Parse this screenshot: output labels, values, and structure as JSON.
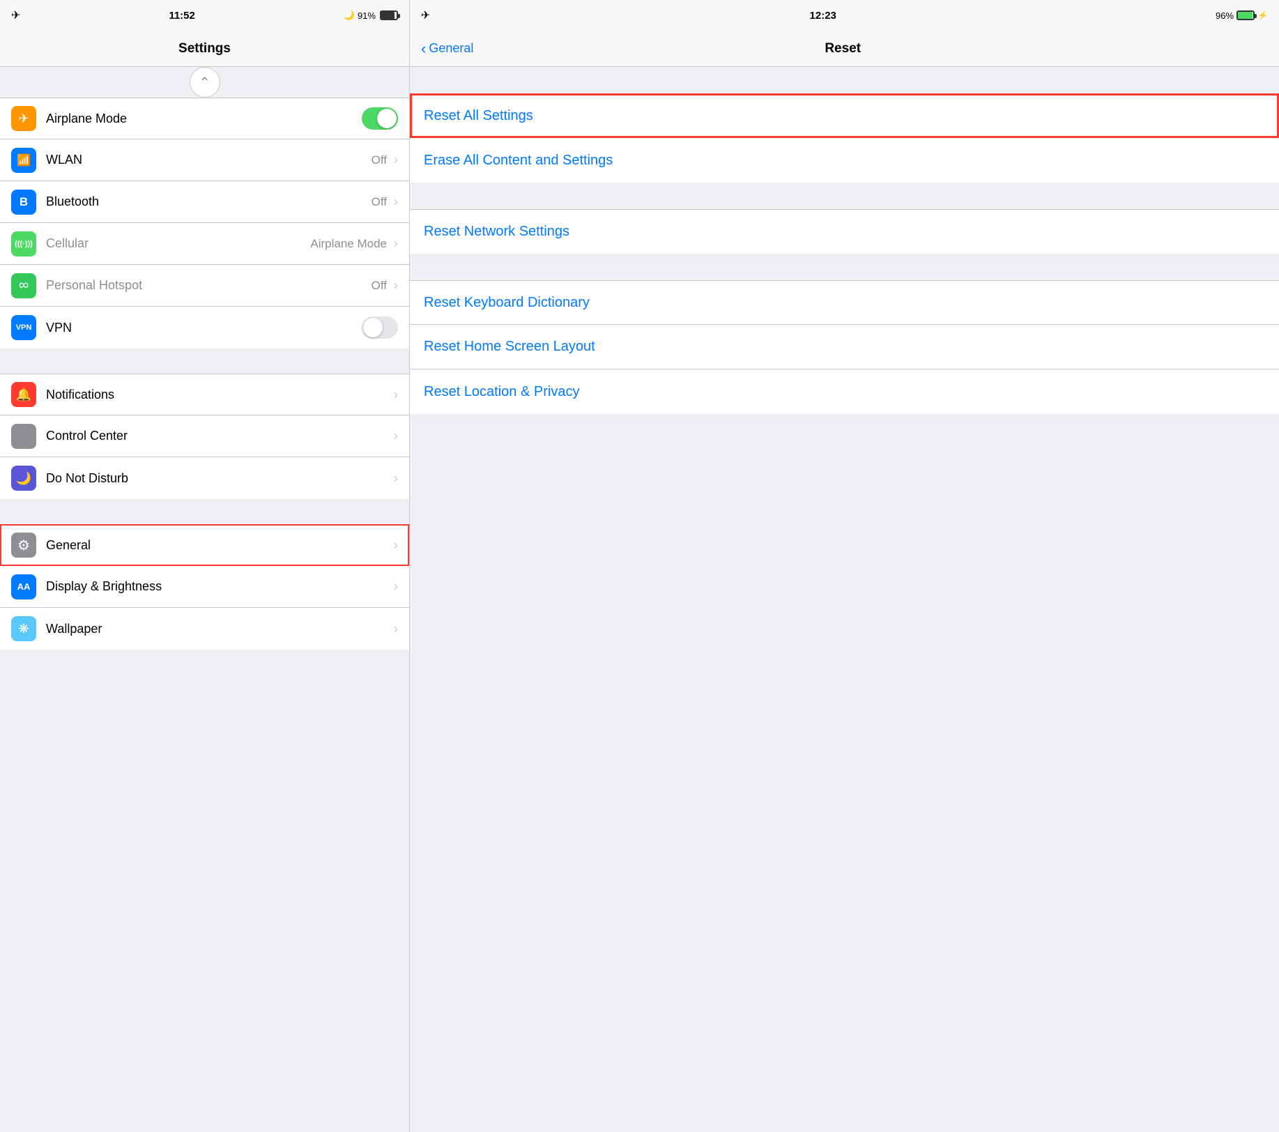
{
  "left": {
    "status": {
      "time": "11:52",
      "battery": "91%",
      "airplane": "✈"
    },
    "title": "Settings",
    "sections": [
      {
        "id": "connectivity",
        "items": [
          {
            "id": "airplane-mode",
            "label": "Airplane Mode",
            "icon": "✈",
            "icon_color": "icon-orange",
            "toggle": true,
            "toggle_on": true
          },
          {
            "id": "wlan",
            "label": "WLAN",
            "icon": "📶",
            "icon_color": "icon-blue",
            "value": "Off",
            "chevron": true
          },
          {
            "id": "bluetooth",
            "label": "Bluetooth",
            "icon": "B",
            "icon_color": "icon-blue-dark",
            "value": "Off",
            "chevron": true
          },
          {
            "id": "cellular",
            "label": "Cellular",
            "icon": "((·))",
            "icon_color": "icon-green",
            "value": "Airplane Mode",
            "chevron": true,
            "gray_label": true
          },
          {
            "id": "personal-hotspot",
            "label": "Personal Hotspot",
            "icon": "∞",
            "icon_color": "icon-green-dark",
            "value": "Off",
            "chevron": true,
            "gray_label": true
          },
          {
            "id": "vpn",
            "label": "VPN",
            "icon": "VPN",
            "icon_color": "icon-blue",
            "toggle": true,
            "toggle_on": false
          }
        ]
      },
      {
        "id": "system",
        "items": [
          {
            "id": "notifications",
            "label": "Notifications",
            "icon": "🔔",
            "icon_color": "icon-red",
            "chevron": true
          },
          {
            "id": "control-center",
            "label": "Control Center",
            "icon": "⊞",
            "icon_color": "icon-gray",
            "chevron": true
          },
          {
            "id": "do-not-disturb",
            "label": "Do Not Disturb",
            "icon": "🌙",
            "icon_color": "icon-purple",
            "chevron": true
          }
        ]
      },
      {
        "id": "more",
        "items": [
          {
            "id": "general",
            "label": "General",
            "icon": "⚙",
            "icon_color": "icon-gray",
            "chevron": true,
            "highlighted": true
          },
          {
            "id": "display-brightness",
            "label": "Display & Brightness",
            "icon": "AA",
            "icon_color": "icon-blue",
            "chevron": true
          },
          {
            "id": "wallpaper",
            "label": "Wallpaper",
            "icon": "❋",
            "icon_color": "icon-teal",
            "chevron": true
          }
        ]
      }
    ]
  },
  "right": {
    "status": {
      "time": "12:23",
      "battery": "96%",
      "airplane": "✈"
    },
    "back_label": "General",
    "title": "Reset",
    "sections": [
      {
        "id": "reset-main",
        "items": [
          {
            "id": "reset-all-settings",
            "label": "Reset All Settings",
            "highlighted": true
          },
          {
            "id": "erase-all",
            "label": "Erase All Content and Settings"
          }
        ]
      },
      {
        "id": "reset-network",
        "items": [
          {
            "id": "reset-network-settings",
            "label": "Reset Network Settings"
          }
        ]
      },
      {
        "id": "reset-more",
        "items": [
          {
            "id": "reset-keyboard",
            "label": "Reset Keyboard Dictionary"
          },
          {
            "id": "reset-home-screen",
            "label": "Reset Home Screen Layout"
          },
          {
            "id": "reset-location-privacy",
            "label": "Reset Location & Privacy"
          }
        ]
      }
    ]
  }
}
